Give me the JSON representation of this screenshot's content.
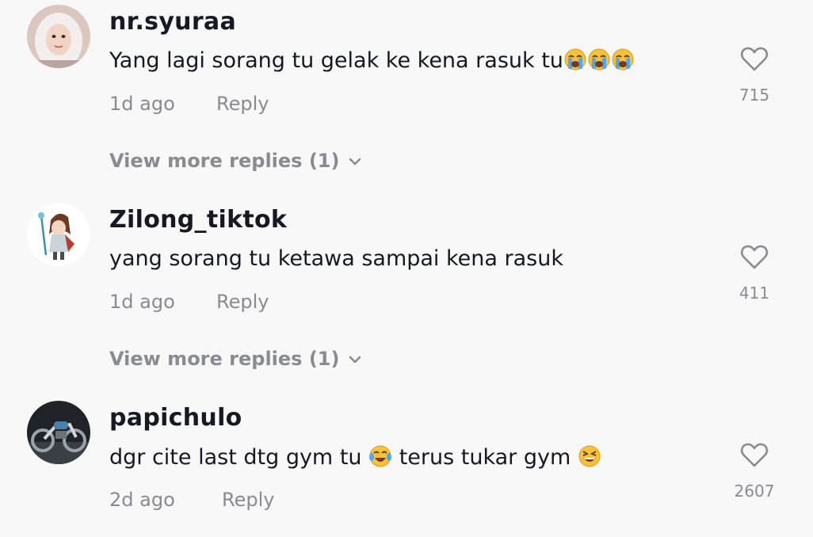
{
  "comments": [
    {
      "username": "nr.syuraa",
      "text": "Yang lagi sorang tu gelak ke kena rasuk tu",
      "emojis": [
        "loudly-crying-face",
        "loudly-crying-face",
        "loudly-crying-face"
      ],
      "time": "1d ago",
      "reply_label": "Reply",
      "likes": "715",
      "view_more": "View more replies (1)",
      "avatar": "woman-hijab-avatar"
    },
    {
      "username": "Zilong_tiktok",
      "text": "yang sorang tu ketawa sampai kena rasuk",
      "time": "1d ago",
      "reply_label": "Reply",
      "likes": "411",
      "view_more": "View more replies (1)",
      "avatar": "anime-character-avatar"
    },
    {
      "username": "papichulo",
      "text_part1": "dgr cite last dtg gym tu",
      "text_part2": "terus tukar gym",
      "emojis": [
        "face-with-tears-of-joy",
        "grinning-squinting-face"
      ],
      "time": "2d ago",
      "reply_label": "Reply",
      "likes": "2607",
      "avatar": "motorcycle-avatar"
    }
  ],
  "colors": {
    "background": "#f8f8f8",
    "primary_text": "#161823",
    "secondary_text": "#8a8b91"
  }
}
